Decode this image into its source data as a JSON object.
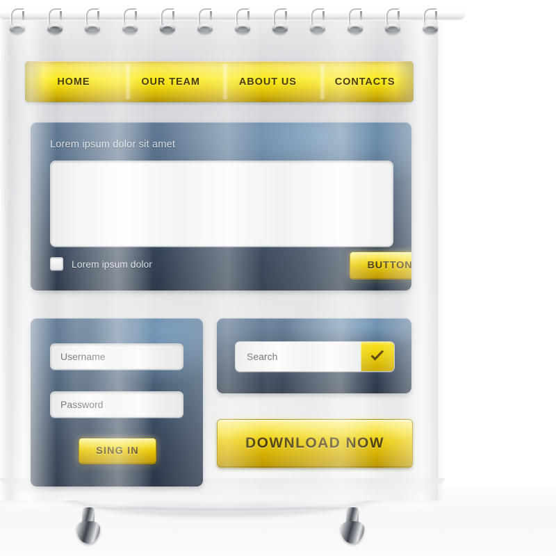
{
  "scene": {
    "product_type": "shower-curtain-mockup",
    "rings_count": 12,
    "tub_feet_count": 2
  },
  "colors": {
    "gold_light": "#fdf27c",
    "gold": "#f3d90a",
    "gold_dark": "#bb9804",
    "gold_text": "#4a3c08",
    "panel_blue_top": "#5d7792",
    "panel_blue_bottom": "#2a3547",
    "curtain_grey": "#d9dbde",
    "field_bg": "#f7f8f8",
    "field_text": "#6f7478",
    "panel_label": "#d7dde4"
  },
  "nav": {
    "items": [
      {
        "label": "HOME"
      },
      {
        "label": "OUR TEAM"
      },
      {
        "label": "ABOUT US"
      },
      {
        "label": "CONTACTS"
      }
    ]
  },
  "main_panel": {
    "title": "Lorem ipsum dolor sit amet",
    "textarea_value": "",
    "checkbox": {
      "label": "Lorem ipsum dolor",
      "checked": false
    },
    "button": {
      "label": "BUTTON"
    }
  },
  "login_panel": {
    "username": {
      "placeholder": "Username",
      "value": ""
    },
    "password": {
      "placeholder": "Password",
      "value": ""
    },
    "submit": {
      "label": "SING IN"
    }
  },
  "search_panel": {
    "input": {
      "placeholder": "Search",
      "value": ""
    },
    "submit_icon": "checkmark-icon"
  },
  "download": {
    "label": "DOWNLOAD NOW"
  }
}
